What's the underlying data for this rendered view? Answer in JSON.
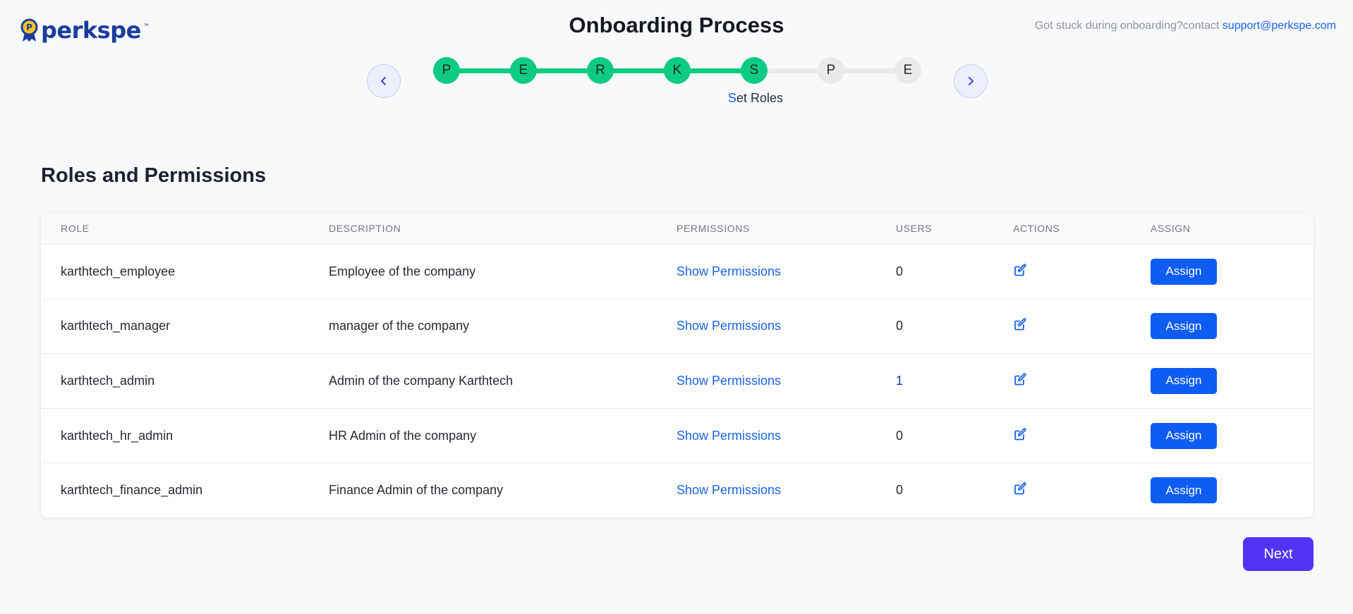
{
  "header": {
    "logo_text": "perkspe",
    "logo_tm": "™",
    "logo_badge_letter": "P",
    "title": "Onboarding Process",
    "help_prefix": "Got stuck during onboarding?contact ",
    "help_email": "support@perkspe.com"
  },
  "stepper": {
    "steps": [
      {
        "letter": "P",
        "status": "done"
      },
      {
        "letter": "E",
        "status": "done"
      },
      {
        "letter": "R",
        "status": "done"
      },
      {
        "letter": "K",
        "status": "done"
      },
      {
        "letter": "S",
        "status": "current"
      },
      {
        "letter": "P",
        "status": "todo"
      },
      {
        "letter": "E",
        "status": "todo"
      }
    ],
    "current_label_first": "S",
    "current_label_rest": "et Roles"
  },
  "section": {
    "title": "Roles and Permissions"
  },
  "table": {
    "columns": [
      "ROLE",
      "DESCRIPTION",
      "PERMISSIONS",
      "USERS",
      "ACTIONS",
      "ASSIGN"
    ],
    "rows": [
      {
        "role": "karthtech_employee",
        "description": "Employee of the company",
        "permissions": "Show Permissions",
        "users": "0",
        "assign": "Assign"
      },
      {
        "role": "karthtech_manager",
        "description": "manager of the company",
        "permissions": "Show Permissions",
        "users": "0",
        "assign": "Assign"
      },
      {
        "role": "karthtech_admin",
        "description": "Admin of the company Karthtech",
        "permissions": "Show Permissions",
        "users": "1",
        "assign": "Assign"
      },
      {
        "role": "karthtech_hr_admin",
        "description": "HR Admin of the company",
        "permissions": "Show Permissions",
        "users": "0",
        "assign": "Assign"
      },
      {
        "role": "karthtech_finance_admin",
        "description": "Finance Admin of the company",
        "permissions": "Show Permissions",
        "users": "0",
        "assign": "Assign"
      }
    ]
  },
  "footer": {
    "next_label": "Next"
  },
  "colors": {
    "step_done": "#0ecb83",
    "step_todo": "#eaeaea",
    "primary_button": "#0d5cf4",
    "next_button": "#5334f4",
    "link": "#1a63e6",
    "brand": "#1a3d9c"
  }
}
